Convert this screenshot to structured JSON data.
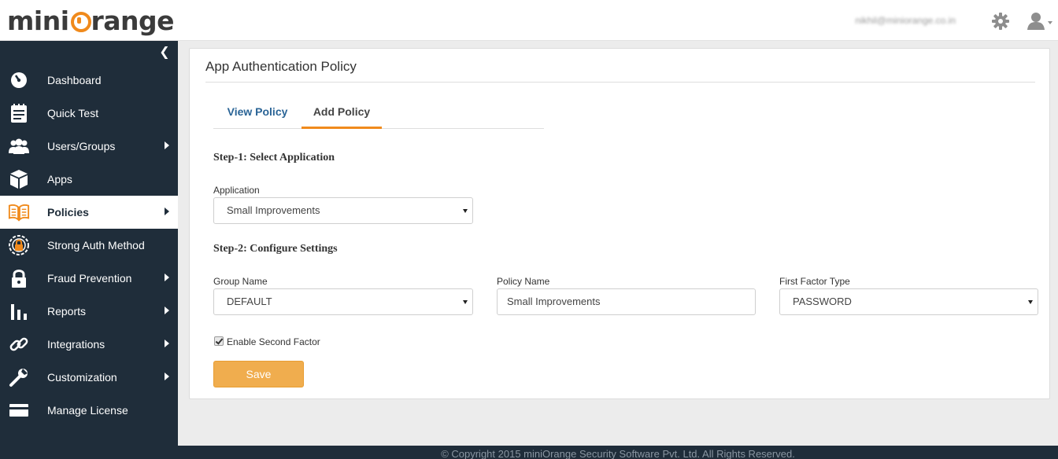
{
  "header": {
    "logo_left": "mini",
    "logo_right": "range",
    "user_email": "nikhil@miniorange.co.in"
  },
  "sidebar": {
    "items": [
      {
        "label": "Dashboard",
        "icon": "dashboard-icon",
        "submenu": false
      },
      {
        "label": "Quick Test",
        "icon": "notepad-icon",
        "submenu": false
      },
      {
        "label": "Users/Groups",
        "icon": "users-icon",
        "submenu": true
      },
      {
        "label": "Apps",
        "icon": "cube-icon",
        "submenu": false
      },
      {
        "label": "Policies",
        "icon": "book-icon",
        "submenu": true,
        "active": true
      },
      {
        "label": "Strong Auth Method",
        "icon": "fingerprint-lock-icon",
        "submenu": false
      },
      {
        "label": "Fraud Prevention",
        "icon": "lock-icon",
        "submenu": true
      },
      {
        "label": "Reports",
        "icon": "bar-chart-icon",
        "submenu": true
      },
      {
        "label": "Integrations",
        "icon": "link-icon",
        "submenu": true
      },
      {
        "label": "Customization",
        "icon": "wrench-icon",
        "submenu": true
      },
      {
        "label": "Manage License",
        "icon": "credit-card-icon",
        "submenu": false
      }
    ]
  },
  "main": {
    "title": "App Authentication Policy",
    "tabs": [
      {
        "label": "View Policy"
      },
      {
        "label": "Add Policy",
        "active": true
      }
    ],
    "step1": "Step-1: Select Application",
    "application_label": "Application",
    "application_value": "Small Improvements",
    "step2": "Step-2: Configure Settings",
    "group_name_label": "Group Name",
    "group_name_value": "DEFAULT",
    "policy_name_label": "Policy Name",
    "policy_name_value": "Small Improvements",
    "first_factor_label": "First Factor Type",
    "first_factor_value": "PASSWORD",
    "second_factor_label": "Enable Second Factor",
    "second_factor_checked": true,
    "save_label": "Save"
  },
  "footer": {
    "text": "© Copyright 2015 miniOrange Security Software Pvt. Ltd. All Rights Reserved."
  },
  "colors": {
    "sidebar_bg": "#1f2d3a",
    "accent_orange": "#f08a1c",
    "save_button": "#f0ad4e",
    "tab_link": "#2a6496"
  }
}
